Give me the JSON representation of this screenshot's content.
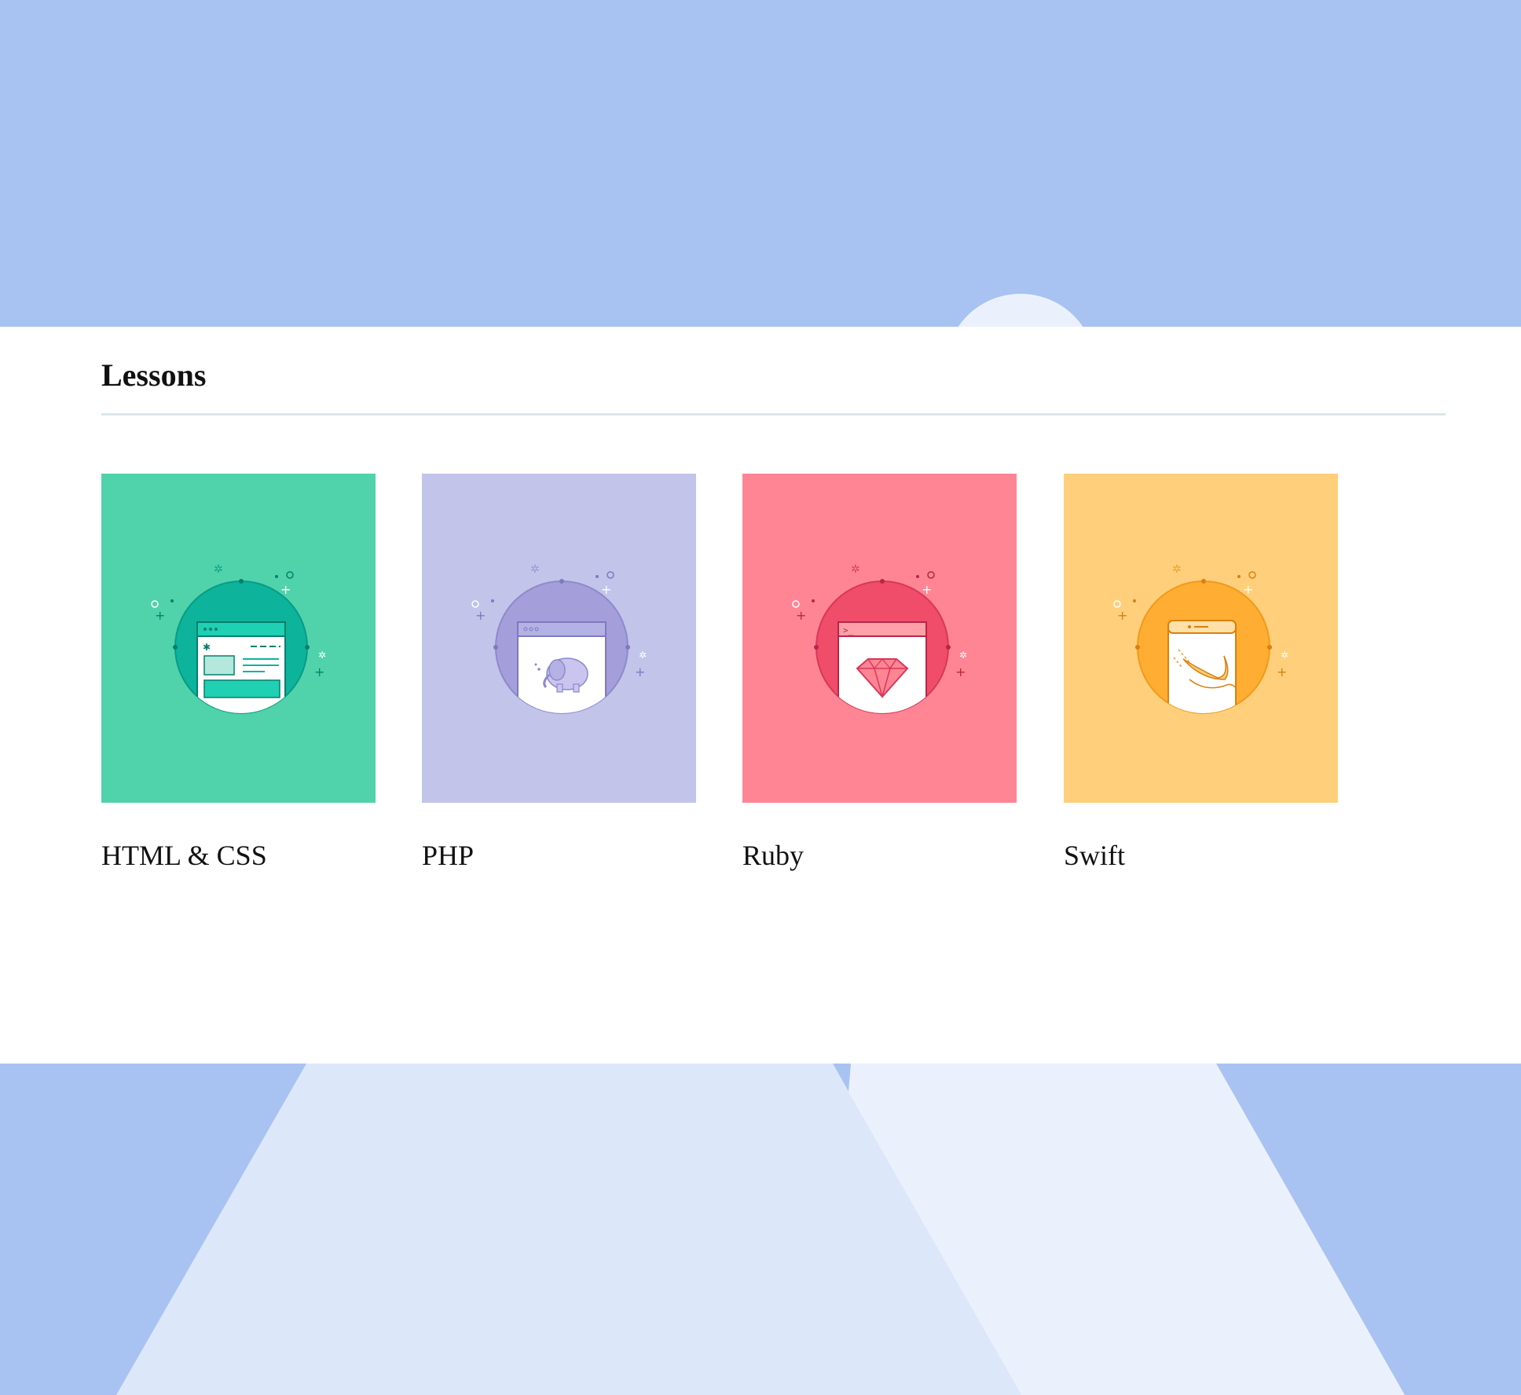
{
  "colors": {
    "sky": "#a8c3f2",
    "mountain_left": "#dce7fa",
    "mountain_right": "#ebf1fc",
    "panel": "#ffffff",
    "divider": "#dbe7ec"
  },
  "section": {
    "title": "Lessons"
  },
  "lessons": [
    {
      "label": "HTML & CSS",
      "icon": "browser-window-icon",
      "bg_color": "#50d2ab",
      "circle_color": "#0db39b",
      "accent_color": "#1fd0b3"
    },
    {
      "label": "PHP",
      "icon": "elephant-icon",
      "bg_color": "#c2c4ea",
      "circle_color": "#a49fda",
      "accent_color": "#b4b2e4"
    },
    {
      "label": "Ruby",
      "icon": "ruby-gem-icon",
      "bg_color": "#ff8594",
      "circle_color": "#f04d6a",
      "accent_color": "#ffa0a8"
    },
    {
      "label": "Swift",
      "icon": "swift-bird-icon",
      "bg_color": "#ffcf7c",
      "circle_color": "#ffad33",
      "accent_color": "#ffe0a8"
    }
  ]
}
